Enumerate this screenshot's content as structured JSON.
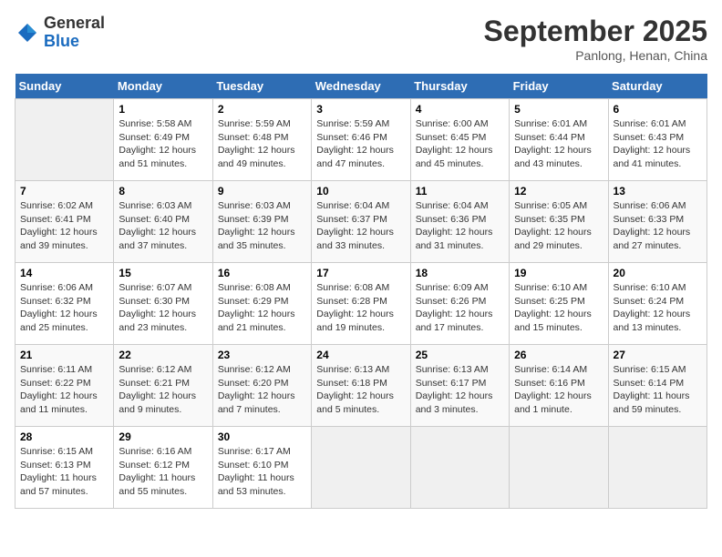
{
  "header": {
    "logo_general": "General",
    "logo_blue": "Blue",
    "month_title": "September 2025",
    "location": "Panlong, Henan, China"
  },
  "days_of_week": [
    "Sunday",
    "Monday",
    "Tuesday",
    "Wednesday",
    "Thursday",
    "Friday",
    "Saturday"
  ],
  "weeks": [
    [
      {
        "day": "",
        "info": ""
      },
      {
        "day": "1",
        "info": "Sunrise: 5:58 AM\nSunset: 6:49 PM\nDaylight: 12 hours\nand 51 minutes."
      },
      {
        "day": "2",
        "info": "Sunrise: 5:59 AM\nSunset: 6:48 PM\nDaylight: 12 hours\nand 49 minutes."
      },
      {
        "day": "3",
        "info": "Sunrise: 5:59 AM\nSunset: 6:46 PM\nDaylight: 12 hours\nand 47 minutes."
      },
      {
        "day": "4",
        "info": "Sunrise: 6:00 AM\nSunset: 6:45 PM\nDaylight: 12 hours\nand 45 minutes."
      },
      {
        "day": "5",
        "info": "Sunrise: 6:01 AM\nSunset: 6:44 PM\nDaylight: 12 hours\nand 43 minutes."
      },
      {
        "day": "6",
        "info": "Sunrise: 6:01 AM\nSunset: 6:43 PM\nDaylight: 12 hours\nand 41 minutes."
      }
    ],
    [
      {
        "day": "7",
        "info": "Sunrise: 6:02 AM\nSunset: 6:41 PM\nDaylight: 12 hours\nand 39 minutes."
      },
      {
        "day": "8",
        "info": "Sunrise: 6:03 AM\nSunset: 6:40 PM\nDaylight: 12 hours\nand 37 minutes."
      },
      {
        "day": "9",
        "info": "Sunrise: 6:03 AM\nSunset: 6:39 PM\nDaylight: 12 hours\nand 35 minutes."
      },
      {
        "day": "10",
        "info": "Sunrise: 6:04 AM\nSunset: 6:37 PM\nDaylight: 12 hours\nand 33 minutes."
      },
      {
        "day": "11",
        "info": "Sunrise: 6:04 AM\nSunset: 6:36 PM\nDaylight: 12 hours\nand 31 minutes."
      },
      {
        "day": "12",
        "info": "Sunrise: 6:05 AM\nSunset: 6:35 PM\nDaylight: 12 hours\nand 29 minutes."
      },
      {
        "day": "13",
        "info": "Sunrise: 6:06 AM\nSunset: 6:33 PM\nDaylight: 12 hours\nand 27 minutes."
      }
    ],
    [
      {
        "day": "14",
        "info": "Sunrise: 6:06 AM\nSunset: 6:32 PM\nDaylight: 12 hours\nand 25 minutes."
      },
      {
        "day": "15",
        "info": "Sunrise: 6:07 AM\nSunset: 6:30 PM\nDaylight: 12 hours\nand 23 minutes."
      },
      {
        "day": "16",
        "info": "Sunrise: 6:08 AM\nSunset: 6:29 PM\nDaylight: 12 hours\nand 21 minutes."
      },
      {
        "day": "17",
        "info": "Sunrise: 6:08 AM\nSunset: 6:28 PM\nDaylight: 12 hours\nand 19 minutes."
      },
      {
        "day": "18",
        "info": "Sunrise: 6:09 AM\nSunset: 6:26 PM\nDaylight: 12 hours\nand 17 minutes."
      },
      {
        "day": "19",
        "info": "Sunrise: 6:10 AM\nSunset: 6:25 PM\nDaylight: 12 hours\nand 15 minutes."
      },
      {
        "day": "20",
        "info": "Sunrise: 6:10 AM\nSunset: 6:24 PM\nDaylight: 12 hours\nand 13 minutes."
      }
    ],
    [
      {
        "day": "21",
        "info": "Sunrise: 6:11 AM\nSunset: 6:22 PM\nDaylight: 12 hours\nand 11 minutes."
      },
      {
        "day": "22",
        "info": "Sunrise: 6:12 AM\nSunset: 6:21 PM\nDaylight: 12 hours\nand 9 minutes."
      },
      {
        "day": "23",
        "info": "Sunrise: 6:12 AM\nSunset: 6:20 PM\nDaylight: 12 hours\nand 7 minutes."
      },
      {
        "day": "24",
        "info": "Sunrise: 6:13 AM\nSunset: 6:18 PM\nDaylight: 12 hours\nand 5 minutes."
      },
      {
        "day": "25",
        "info": "Sunrise: 6:13 AM\nSunset: 6:17 PM\nDaylight: 12 hours\nand 3 minutes."
      },
      {
        "day": "26",
        "info": "Sunrise: 6:14 AM\nSunset: 6:16 PM\nDaylight: 12 hours\nand 1 minute."
      },
      {
        "day": "27",
        "info": "Sunrise: 6:15 AM\nSunset: 6:14 PM\nDaylight: 11 hours\nand 59 minutes."
      }
    ],
    [
      {
        "day": "28",
        "info": "Sunrise: 6:15 AM\nSunset: 6:13 PM\nDaylight: 11 hours\nand 57 minutes."
      },
      {
        "day": "29",
        "info": "Sunrise: 6:16 AM\nSunset: 6:12 PM\nDaylight: 11 hours\nand 55 minutes."
      },
      {
        "day": "30",
        "info": "Sunrise: 6:17 AM\nSunset: 6:10 PM\nDaylight: 11 hours\nand 53 minutes."
      },
      {
        "day": "",
        "info": ""
      },
      {
        "day": "",
        "info": ""
      },
      {
        "day": "",
        "info": ""
      },
      {
        "day": "",
        "info": ""
      }
    ]
  ]
}
